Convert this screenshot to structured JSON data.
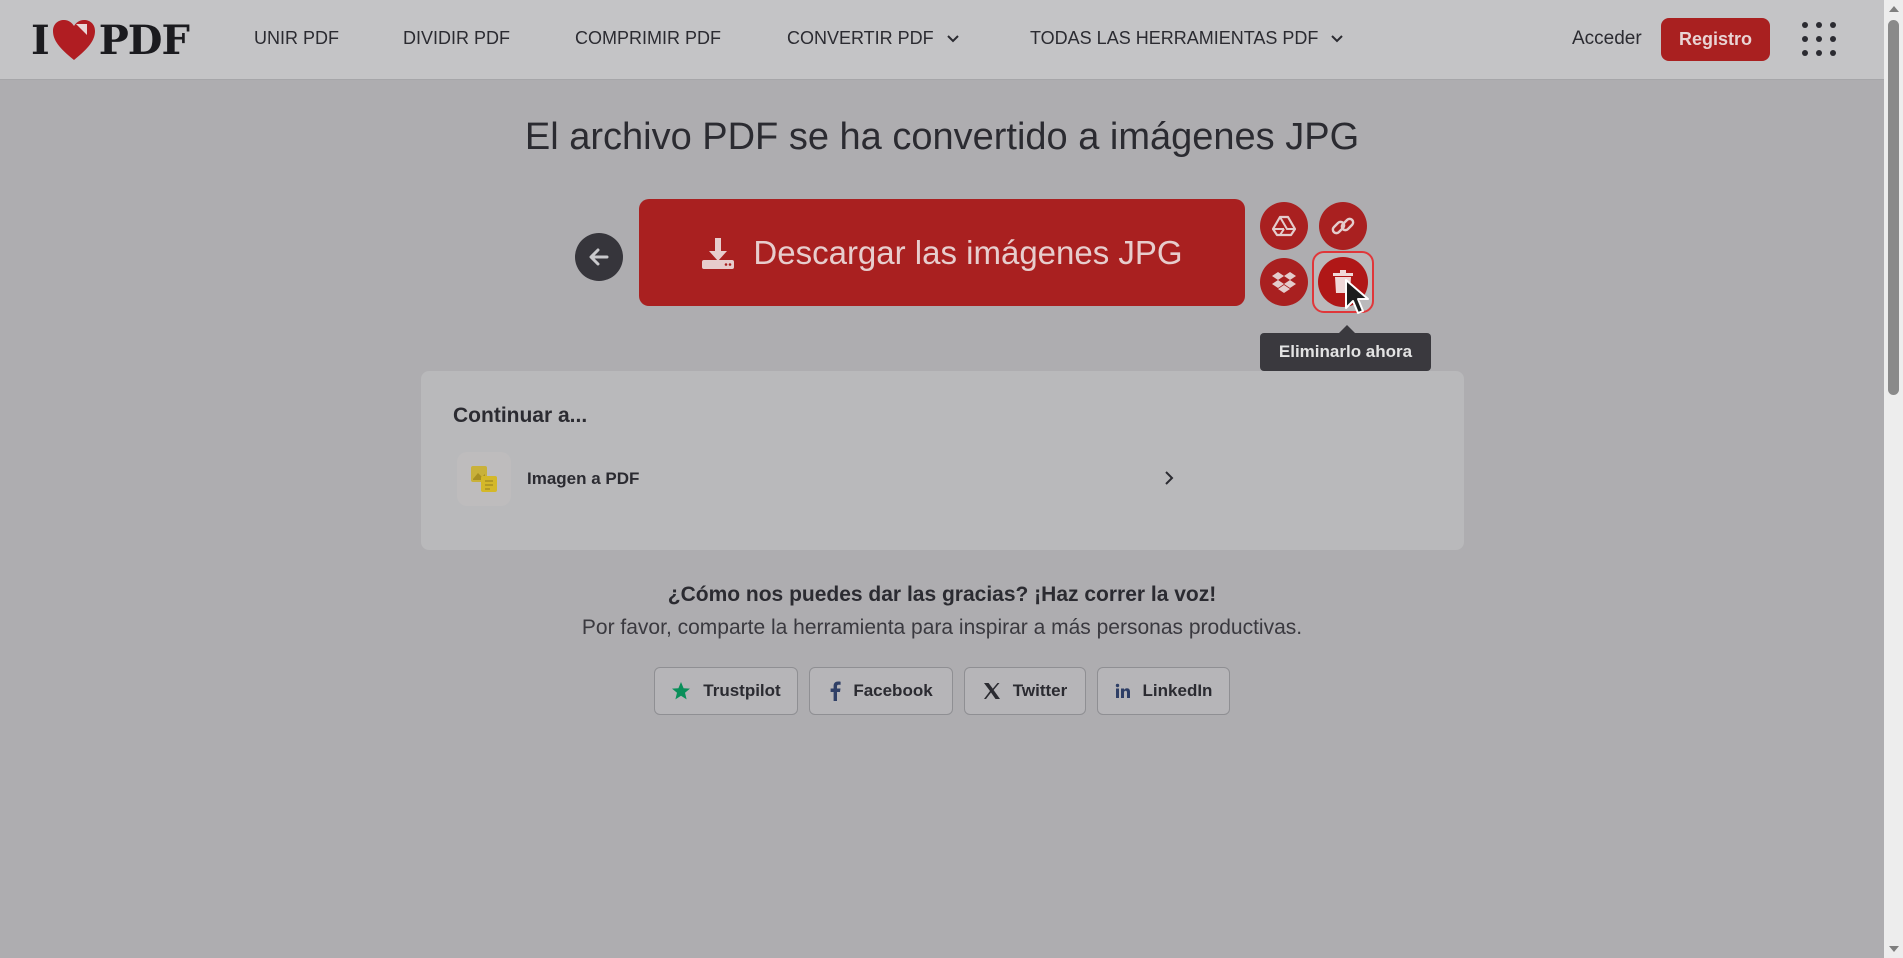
{
  "header": {
    "logo_left": "I",
    "logo_right": "PDF",
    "nav": [
      {
        "label": "UNIR PDF"
      },
      {
        "label": "DIVIDIR PDF"
      },
      {
        "label": "COMPRIMIR PDF"
      },
      {
        "label": "CONVERTIR PDF"
      },
      {
        "label": "TODAS LAS HERRAMIENTAS PDF"
      }
    ],
    "login": "Acceder",
    "register": "Registro"
  },
  "main": {
    "title": "El archivo PDF se ha convertido a imágenes JPG",
    "download_label": "Descargar las imágenes JPG",
    "tooltip": "Eliminarlo ahora",
    "side_buttons": [
      "google-drive-icon",
      "link-icon",
      "dropbox-icon",
      "trash-icon"
    ]
  },
  "continue": {
    "title": "Continuar a...",
    "items": [
      {
        "label": "Imagen a PDF",
        "icon": "image-to-pdf-icon"
      }
    ]
  },
  "share": {
    "title": "¿Cómo nos puedes dar las gracias? ¡Haz correr la voz!",
    "subtitle": "Por favor, comparte la herramienta para inspirar a más personas productivas.",
    "buttons": [
      {
        "label": "Trustpilot",
        "icon": "star-icon"
      },
      {
        "label": "Facebook",
        "icon": "facebook-icon"
      },
      {
        "label": "Twitter",
        "icon": "x-icon"
      },
      {
        "label": "LinkedIn",
        "icon": "linkedin-icon"
      }
    ]
  },
  "colors": {
    "brand_red": "#a92020",
    "overlay_bg": "#aeadb0",
    "dark": "#2b2b31",
    "trustpilot_green": "#00a86b"
  }
}
